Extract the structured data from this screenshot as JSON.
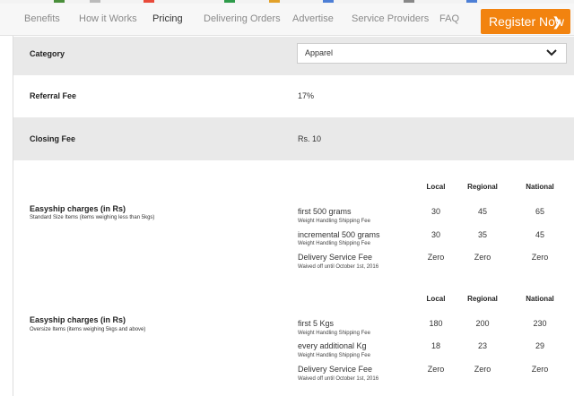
{
  "nav": {
    "items": [
      "Benefits",
      "How it Works",
      "Pricing",
      "Delivering Orders",
      "Advertise",
      "Service Providers",
      "FAQ"
    ],
    "active": "Pricing",
    "register_label": "Register Now",
    "register_color": "#f2830f"
  },
  "category": {
    "label": "Category",
    "selected": "Apparel"
  },
  "referral": {
    "label": "Referral Fee",
    "value": "17%"
  },
  "closing": {
    "label": "Closing Fee",
    "value": "Rs. 10"
  },
  "columns": [
    "Local",
    "Regional",
    "National"
  ],
  "easyship_standard": {
    "title": "Easyship charges (in Rs)",
    "subtitle": "Standard Size Items (items weighing less than 5kgs)",
    "rows": [
      {
        "name": "first 500 grams",
        "sub": "Weight Handling Shipping Fee",
        "values": [
          "30",
          "45",
          "65"
        ]
      },
      {
        "name": "incremental 500 grams",
        "sub": "Weight Handling Shipping Fee",
        "values": [
          "30",
          "35",
          "45"
        ]
      },
      {
        "name": "Delivery Service Fee",
        "sub": "Waived off until October 1st, 2016",
        "values": [
          "Zero",
          "Zero",
          "Zero"
        ]
      }
    ]
  },
  "easyship_oversize": {
    "title": "Easyship charges (in Rs)",
    "subtitle": "Oversize Items (items weighing 5kgs and above)",
    "rows": [
      {
        "name": "first 5 Kgs",
        "sub": "Weight Handling Shipping Fee",
        "values": [
          "180",
          "200",
          "230"
        ]
      },
      {
        "name": "every additional Kg",
        "sub": "Weight Handling Shipping Fee",
        "values": [
          "18",
          "23",
          "29"
        ]
      },
      {
        "name": "Delivery Service Fee",
        "sub": "Waived off until October 1st, 2016",
        "values": [
          "Zero",
          "Zero",
          "Zero"
        ]
      }
    ]
  }
}
